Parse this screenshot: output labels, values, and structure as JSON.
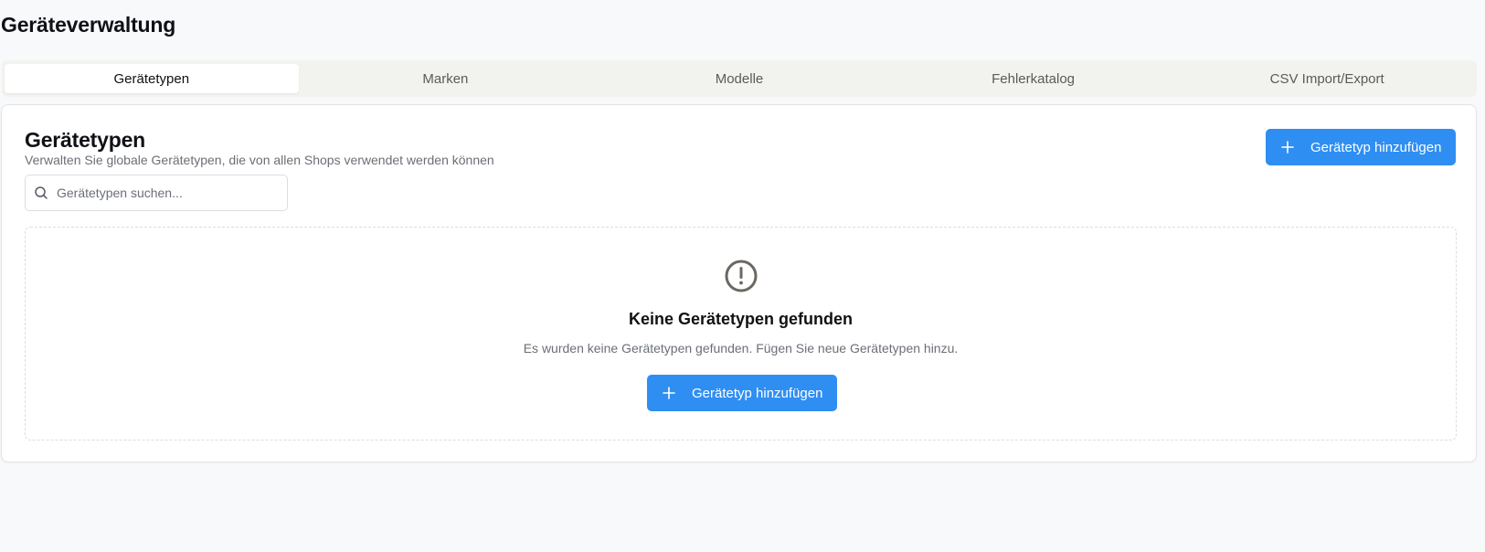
{
  "page": {
    "title": "Geräteverwaltung"
  },
  "tabs": [
    {
      "label": "Gerätetypen",
      "active": true
    },
    {
      "label": "Marken",
      "active": false
    },
    {
      "label": "Modelle",
      "active": false
    },
    {
      "label": "Fehlerkatalog",
      "active": false
    },
    {
      "label": "CSV Import/Export",
      "active": false
    }
  ],
  "card": {
    "title": "Gerätetypen",
    "subtitle": "Verwalten Sie globale Gerätetypen, die von allen Shops verwendet werden können",
    "add_button_label": "Gerätetyp hinzufügen",
    "add_button_icon": "plus-icon"
  },
  "search": {
    "placeholder": "Gerätetypen suchen...",
    "value": "",
    "icon": "search-icon"
  },
  "empty_state": {
    "icon": "alert-circle-icon",
    "title": "Keine Gerätetypen gefunden",
    "description": "Es wurden keine Gerätetypen gefunden. Fügen Sie neue Gerätetypen hinzu.",
    "button_label": "Gerätetyp hinzufügen"
  },
  "colors": {
    "accent": "#2f8ef2",
    "background": "#f8f9fb",
    "tab_bar": "#f2f2ef",
    "muted_text": "#6b6f76"
  }
}
